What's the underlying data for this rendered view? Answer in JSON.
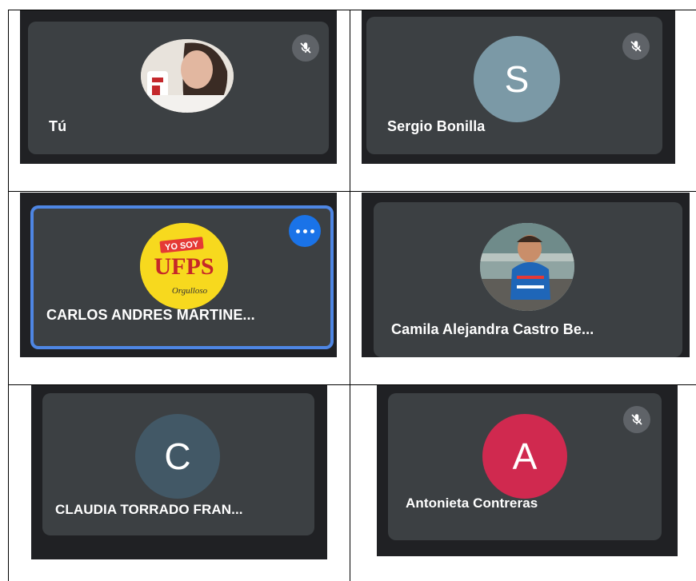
{
  "colors": {
    "tile_bg": "#3c4043",
    "page_bg": "#202124",
    "active_border": "#4e86e4",
    "more_button": "#1a73e8"
  },
  "participants": [
    {
      "name": "Tú",
      "avatar_type": "photo",
      "muted": true
    },
    {
      "name": "Sergio Bonilla",
      "avatar_type": "initial",
      "initial": "S",
      "avatar_color": "#7b99a6",
      "muted": true
    },
    {
      "name": "CARLOS ANDRES MARTINE...",
      "avatar_type": "logo",
      "active": true,
      "logo": {
        "top": "YO SOY",
        "main": "UFPS",
        "sub": "Orgulloso"
      }
    },
    {
      "name": "Camila Alejandra Castro Be...",
      "avatar_type": "photo",
      "muted": false
    },
    {
      "name": "CLAUDIA TORRADO FRAN...",
      "avatar_type": "initial",
      "initial": "C",
      "avatar_color": "#425866",
      "muted": false
    },
    {
      "name": "Antonieta Contreras",
      "avatar_type": "initial",
      "initial": "A",
      "avatar_color": "#d0294f",
      "muted": true
    }
  ],
  "icons": {
    "muted": "mic-off-icon",
    "more_options": "more-horiz-icon"
  }
}
